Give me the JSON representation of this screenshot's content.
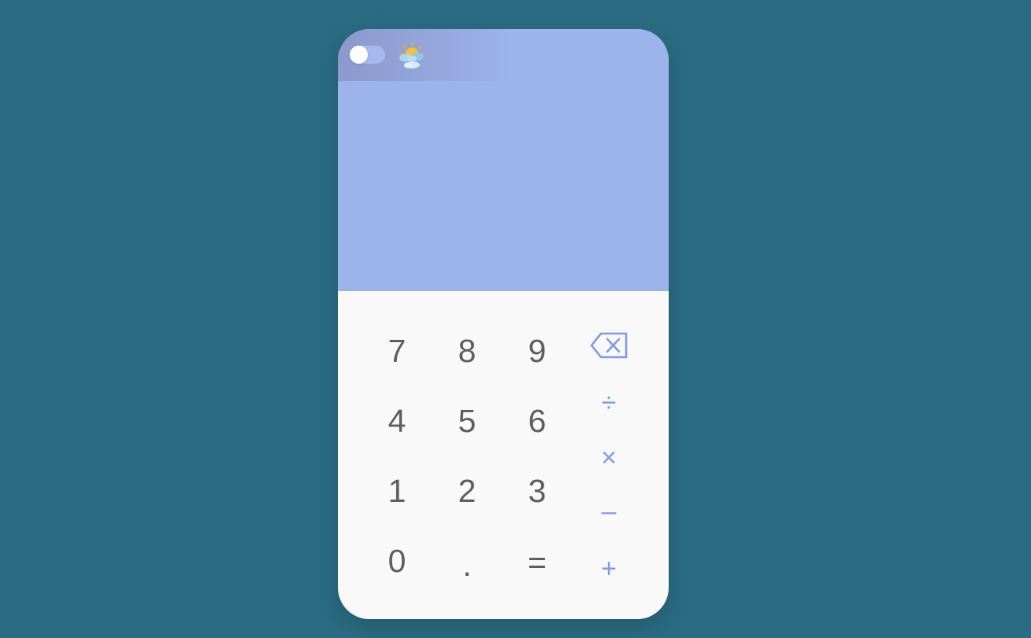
{
  "calculator": {
    "result": "",
    "theme_toggle": {
      "state": "off"
    },
    "weather_icon": "sun-behind-cloud-icon",
    "digits": [
      "7",
      "8",
      "9",
      "4",
      "5",
      "6",
      "1",
      "2",
      "3",
      "0",
      ".",
      "="
    ],
    "operators": {
      "backspace": "backspace-icon",
      "divide": "÷",
      "multiply": "×",
      "subtract": "–",
      "add": "+"
    }
  },
  "colors": {
    "background": "#2b6c83",
    "display": "#9db3ec",
    "keypad": "#f9f9f9",
    "digit_text": "#5e5e5e",
    "operator_text": "#7f9be6"
  }
}
